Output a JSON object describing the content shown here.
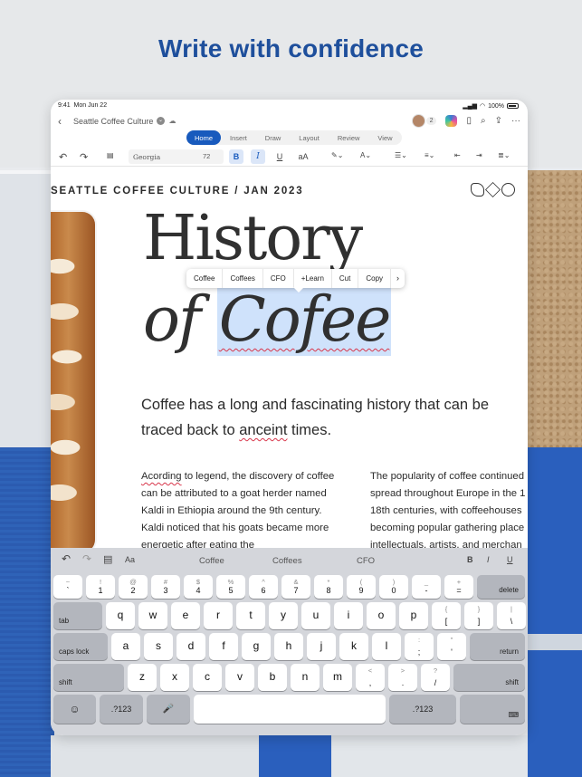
{
  "hero": {
    "title": "Write with confidence"
  },
  "status": {
    "time": "9:41",
    "date": "Mon Jun 22",
    "battery": "100%"
  },
  "titlebar": {
    "doc_title": "Seattle Coffee Culture",
    "collab_count": "2"
  },
  "ribbon": {
    "tabs": [
      "Home",
      "Insert",
      "Draw",
      "Layout",
      "Review",
      "View"
    ],
    "active": "Home"
  },
  "toolbar": {
    "font": "Georgia",
    "size": "72",
    "bold": "B",
    "italic": "I",
    "underline": "U",
    "case": "aA"
  },
  "doc": {
    "header": "SEATTLE COFFEE CULTURE /  JAN 2023",
    "title_line1": "History",
    "title_line2_pre": "of ",
    "title_line2_sel": "Cofee",
    "lead_a": "Coffee has a long and fascinating history that can be traced back to ",
    "lead_misspell": "anceint",
    "lead_b": " times.",
    "col1_misspell": "Acording",
    "col1_rest": " to legend, the discovery of coffee can be attributed to a goat herder named Kaldi in Ethiopia around the 9th century. Kaldi noticed that his goats became more energetic after eating the",
    "col2_lines": [
      "The popularity of coffee continued",
      "spread throughout Europe in the 1",
      "18th centuries, with coffeehouses",
      "becoming popular gathering place",
      "intellectuals, artists, and merchan"
    ]
  },
  "context_menu": {
    "items": [
      "Coffee",
      "Coffees",
      "CFO",
      "+Learn",
      "Cut",
      "Copy"
    ],
    "more": "›"
  },
  "keyboard": {
    "suggestions": [
      "Coffee",
      "Coffees",
      "CFO"
    ],
    "format_label": "Aa",
    "bold": "B",
    "italic": "I",
    "underline": "U",
    "row_numbers": [
      {
        "main": "`",
        "alt": "~"
      },
      {
        "main": "1",
        "alt": "!"
      },
      {
        "main": "2",
        "alt": "@"
      },
      {
        "main": "3",
        "alt": "#"
      },
      {
        "main": "4",
        "alt": "$"
      },
      {
        "main": "5",
        "alt": "%"
      },
      {
        "main": "6",
        "alt": "^"
      },
      {
        "main": "7",
        "alt": "&"
      },
      {
        "main": "8",
        "alt": "*"
      },
      {
        "main": "9",
        "alt": "("
      },
      {
        "main": "0",
        "alt": ")"
      },
      {
        "main": "-",
        "alt": "_"
      },
      {
        "main": "=",
        "alt": "+"
      }
    ],
    "delete": "delete",
    "tab": "tab",
    "row_q": [
      "q",
      "w",
      "e",
      "r",
      "t",
      "y",
      "u",
      "i",
      "o",
      "p"
    ],
    "row_q_sym": [
      {
        "main": "[",
        "alt": "{"
      },
      {
        "main": "]",
        "alt": "}"
      },
      {
        "main": "\\",
        "alt": "|"
      }
    ],
    "caps": "caps lock",
    "row_a": [
      "a",
      "s",
      "d",
      "f",
      "g",
      "h",
      "j",
      "k",
      "l"
    ],
    "row_a_sym": [
      {
        "main": ";",
        "alt": ":"
      },
      {
        "main": "'",
        "alt": "\""
      }
    ],
    "return": "return",
    "shift": "shift",
    "row_z": [
      "z",
      "x",
      "c",
      "v",
      "b",
      "n",
      "m"
    ],
    "row_z_sym": [
      {
        "main": ",",
        "alt": "<"
      },
      {
        "main": ".",
        "alt": ">"
      },
      {
        "main": "/",
        "alt": "?"
      }
    ],
    "numeric_toggle": ".?123",
    "emoji": "☺",
    "mic": "🎤",
    "hide": "⌨"
  }
}
